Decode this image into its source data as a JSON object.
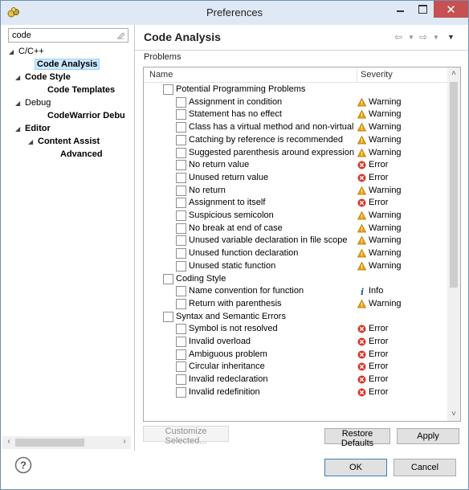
{
  "window": {
    "title": "Preferences"
  },
  "left": {
    "filter_value": "code",
    "tree": [
      {
        "label": "C/C++",
        "twisty": "◢",
        "bold": false
      },
      {
        "label": "Code Analysis",
        "twisty": "",
        "bold": true,
        "selected": true
      },
      {
        "label": "Code Style",
        "twisty": "◢",
        "bold": true
      },
      {
        "label": "Code Templates",
        "twisty": "",
        "bold": true
      },
      {
        "label": "Debug",
        "twisty": "◢",
        "bold": false
      },
      {
        "label": "CodeWarrior Debu",
        "twisty": "",
        "bold": true
      },
      {
        "label": "Editor",
        "twisty": "◢",
        "bold": true
      },
      {
        "label": "Content Assist",
        "twisty": "◢",
        "bold": true
      },
      {
        "label": "Advanced",
        "twisty": "",
        "bold": true
      }
    ]
  },
  "page": {
    "title": "Code Analysis",
    "section_label": "Problems",
    "columns": {
      "name": "Name",
      "severity": "Severity"
    },
    "rows": [
      {
        "level": 0,
        "name": "Potential Programming Problems",
        "severity": ""
      },
      {
        "level": 1,
        "name": "Assignment in condition",
        "severity": "Warning"
      },
      {
        "level": 1,
        "name": "Statement has no effect",
        "severity": "Warning"
      },
      {
        "level": 1,
        "name": "Class has a virtual method and non-virtual de",
        "severity": "Warning"
      },
      {
        "level": 1,
        "name": "Catching by reference is recommended",
        "severity": "Warning"
      },
      {
        "level": 1,
        "name": "Suggested parenthesis around expression",
        "severity": "Warning"
      },
      {
        "level": 1,
        "name": "No return value",
        "severity": "Error"
      },
      {
        "level": 1,
        "name": "Unused return value",
        "severity": "Error"
      },
      {
        "level": 1,
        "name": "No return",
        "severity": "Warning"
      },
      {
        "level": 1,
        "name": "Assignment to itself",
        "severity": "Error"
      },
      {
        "level": 1,
        "name": "Suspicious semicolon",
        "severity": "Warning"
      },
      {
        "level": 1,
        "name": "No break at end of case",
        "severity": "Warning"
      },
      {
        "level": 1,
        "name": "Unused variable declaration in file scope",
        "severity": "Warning"
      },
      {
        "level": 1,
        "name": "Unused function declaration",
        "severity": "Warning"
      },
      {
        "level": 1,
        "name": "Unused static function",
        "severity": "Warning"
      },
      {
        "level": 0,
        "name": "Coding Style",
        "severity": ""
      },
      {
        "level": 1,
        "name": "Name convention for function",
        "severity": "Info"
      },
      {
        "level": 1,
        "name": "Return with parenthesis",
        "severity": "Warning"
      },
      {
        "level": 0,
        "name": "Syntax and Semantic Errors",
        "severity": ""
      },
      {
        "level": 1,
        "name": "Symbol is not resolved",
        "severity": "Error"
      },
      {
        "level": 1,
        "name": "Invalid overload",
        "severity": "Error"
      },
      {
        "level": 1,
        "name": "Ambiguous problem",
        "severity": "Error"
      },
      {
        "level": 1,
        "name": "Circular inheritance",
        "severity": "Error"
      },
      {
        "level": 1,
        "name": "Invalid redeclaration",
        "severity": "Error"
      },
      {
        "level": 1,
        "name": "Invalid redefinition",
        "severity": "Error"
      }
    ],
    "customize_label": "Customize Selected...",
    "restore_label": "Restore Defaults",
    "apply_label": "Apply"
  },
  "footer": {
    "ok_label": "OK",
    "cancel_label": "Cancel"
  },
  "colors": {
    "warning": "#f0a30a",
    "error": "#d9372b",
    "info": "#1f5fa8",
    "selection": "#cce8ff",
    "close_button": "#c75050"
  }
}
